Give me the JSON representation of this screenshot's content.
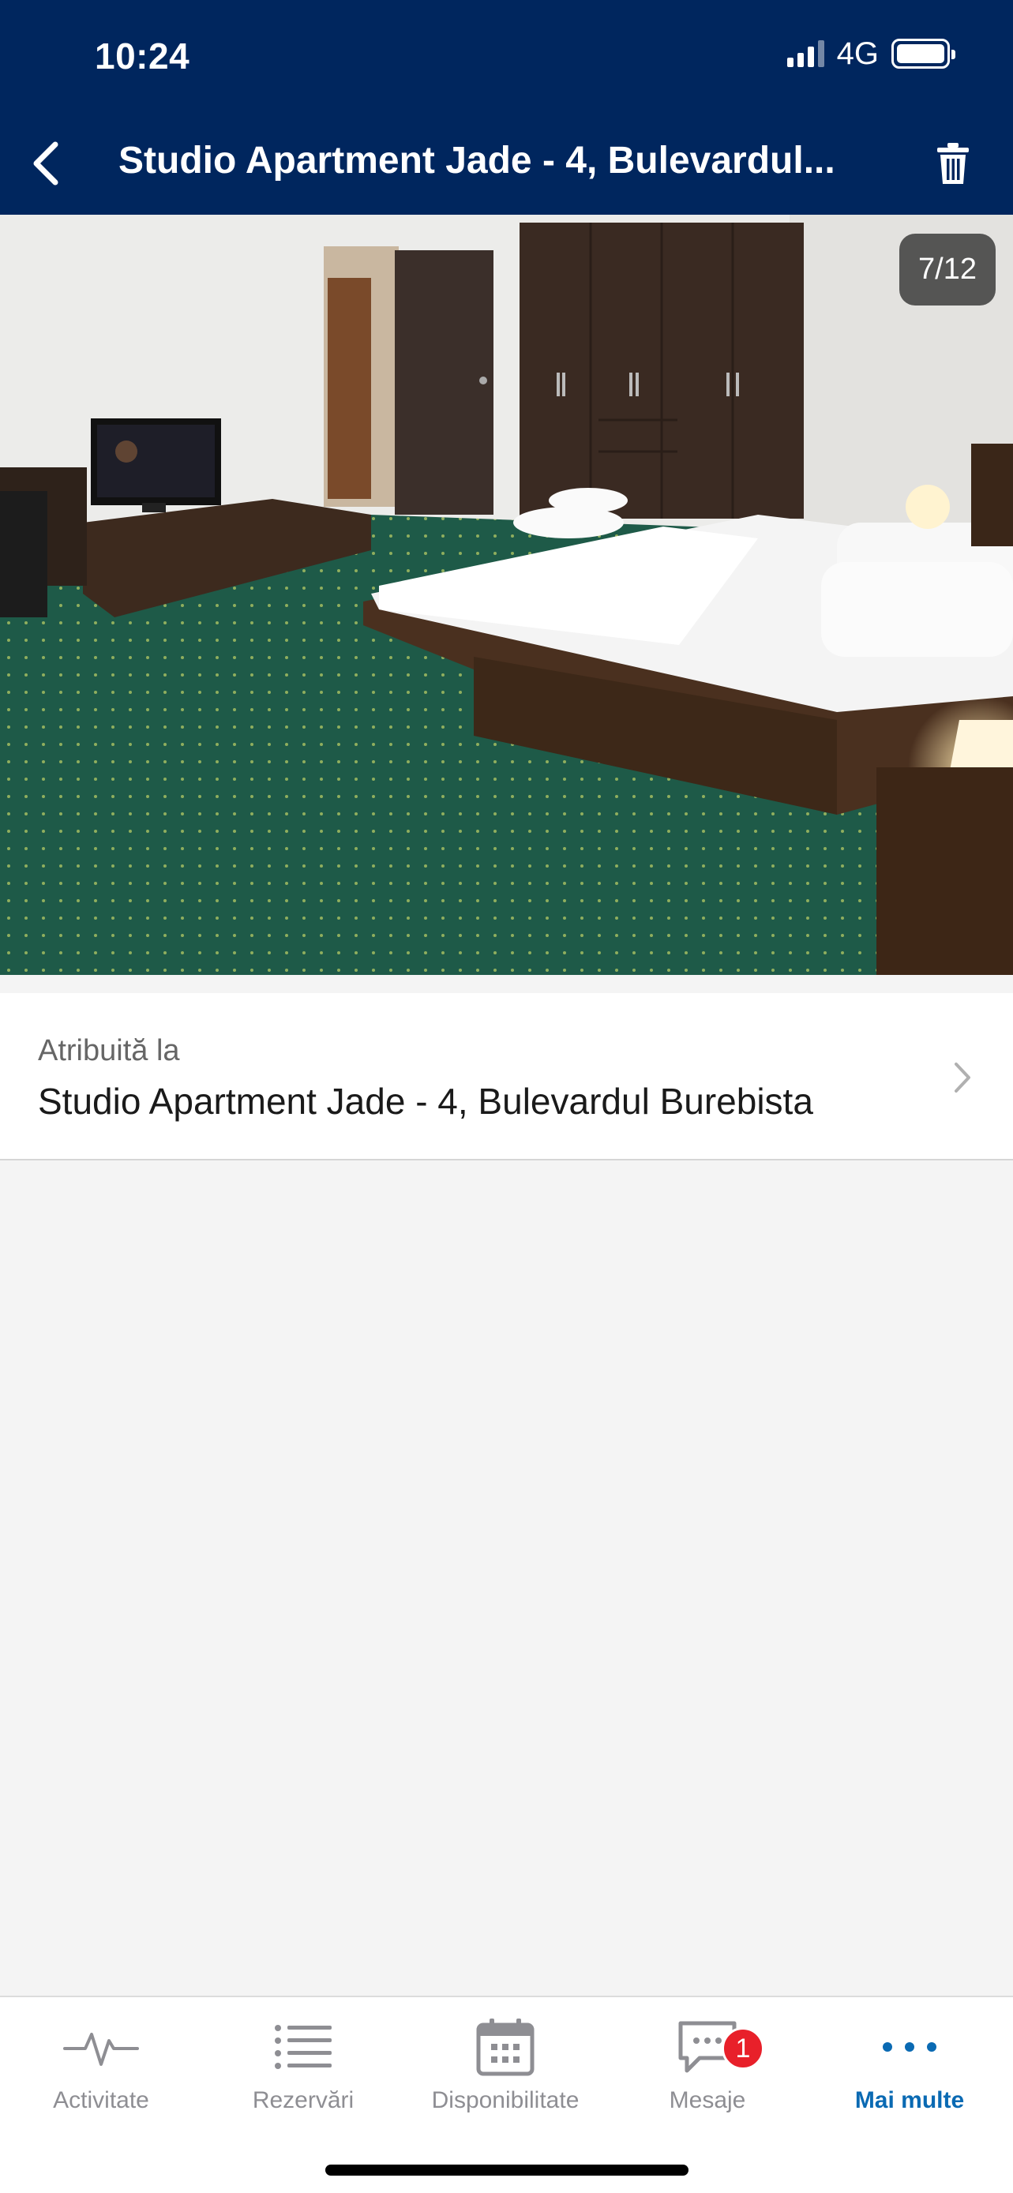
{
  "status_bar": {
    "time": "10:24",
    "network": "4G"
  },
  "header": {
    "title": "Studio Apartment Jade - 4, Bulevardul..."
  },
  "photo": {
    "counter": "7/12"
  },
  "assigned": {
    "label": "Atribuită la",
    "value": "Studio Apartment Jade - 4, Bulevardul Burebista"
  },
  "tabs": [
    {
      "label": "Activitate",
      "icon": "activity-icon"
    },
    {
      "label": "Rezervări",
      "icon": "list-icon"
    },
    {
      "label": "Disponibilitate",
      "icon": "calendar-icon"
    },
    {
      "label": "Mesaje",
      "icon": "message-icon",
      "badge": "1"
    },
    {
      "label": "Mai multe",
      "icon": "more-icon"
    }
  ],
  "colors": {
    "header_bg": "#00265e",
    "accent": "#0a6ab3",
    "badge": "#e8202a",
    "inactive": "#8e8e93"
  }
}
